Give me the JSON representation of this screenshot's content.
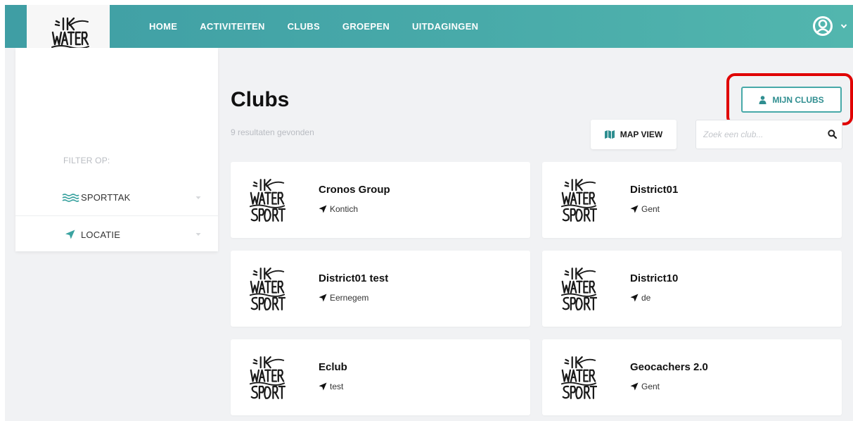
{
  "brand": {
    "logo_alt": "IK WATER SPORT"
  },
  "nav": {
    "items": [
      {
        "label": "HOME"
      },
      {
        "label": "ACTIVITEITEN"
      },
      {
        "label": "CLUBS"
      },
      {
        "label": "GROEPEN"
      },
      {
        "label": "UITDAGINGEN"
      }
    ],
    "user_icon": "user-circle-icon",
    "dropdown_icon": "chevron-down-icon"
  },
  "sidebar": {
    "filter_title": "FILTER OP:",
    "filters": [
      {
        "label": "SPORTTAK",
        "icon": "waves-icon"
      },
      {
        "label": "LOCATIE",
        "icon": "location-arrow-icon"
      }
    ]
  },
  "main": {
    "title": "Clubs",
    "results": "9 resultaten gevonden",
    "mijn_clubs_label": "MIJN CLUBS",
    "map_view_label": "MAP VIEW",
    "search_placeholder": "Zoek een club..."
  },
  "clubs": [
    {
      "name": "Cronos Group",
      "location": "Kontich"
    },
    {
      "name": "District01",
      "location": "Gent"
    },
    {
      "name": "District01 test",
      "location": "Eernegem"
    },
    {
      "name": "District10",
      "location": "de"
    },
    {
      "name": "Eclub",
      "location": "test"
    },
    {
      "name": "Geocachers 2.0",
      "location": "Gent"
    }
  ],
  "colors": {
    "teal": "#48aaa9",
    "teal_dark": "#2f8e90",
    "highlight": "#e00000",
    "background": "#f1f2f4"
  }
}
